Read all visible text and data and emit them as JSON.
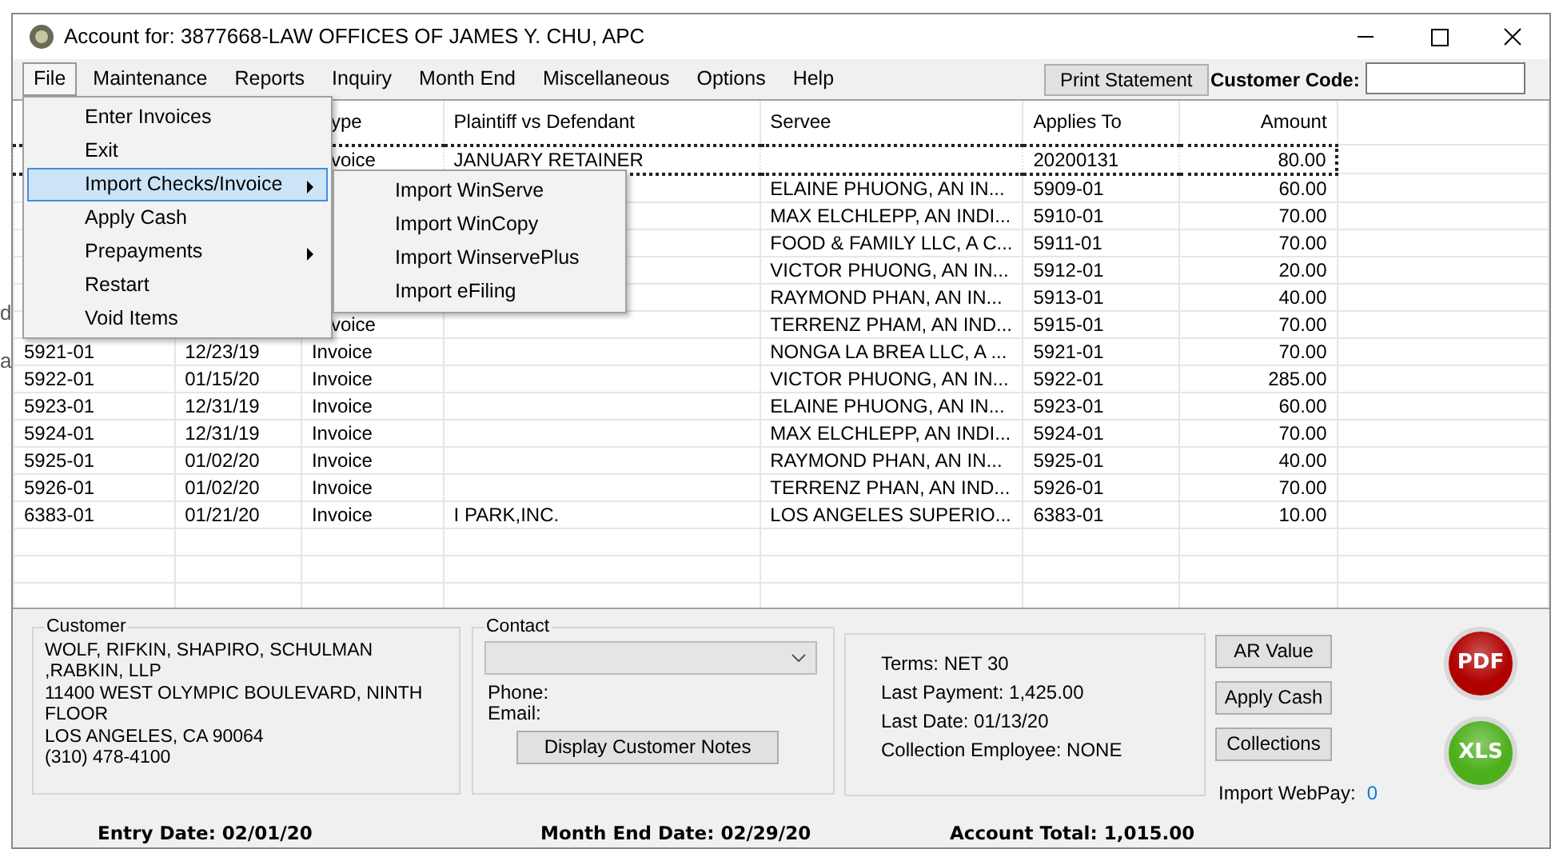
{
  "background_fragments": [
    "d",
    "a"
  ],
  "window": {
    "title": "Account for: 3877668-LAW OFFICES OF JAMES Y. CHU, APC"
  },
  "menu_bar": {
    "items": [
      {
        "label": "File",
        "selected": true
      },
      {
        "label": "Maintenance",
        "selected": false
      },
      {
        "label": "Reports",
        "selected": false
      },
      {
        "label": "Inquiry",
        "selected": false
      },
      {
        "label": "Month End",
        "selected": false
      },
      {
        "label": "Miscellaneous",
        "selected": false
      },
      {
        "label": "Options",
        "selected": false
      },
      {
        "label": "Help",
        "selected": false
      }
    ]
  },
  "print_button": "Print Statement",
  "customer_code": {
    "label": "Customer Code:"
  },
  "file_menu": {
    "items": [
      {
        "label": "Enter Invoices",
        "selected": false,
        "submenu": false
      },
      {
        "label": "Exit",
        "selected": false,
        "submenu": false
      },
      {
        "label": "Import Checks/Invoice",
        "selected": true,
        "submenu": true
      },
      {
        "label": "Apply Cash",
        "selected": false,
        "submenu": false
      },
      {
        "label": "Prepayments",
        "selected": false,
        "submenu": true
      },
      {
        "label": "Restart",
        "selected": false,
        "submenu": false
      },
      {
        "label": "Void Items",
        "selected": false,
        "submenu": false
      }
    ]
  },
  "submenu": {
    "items": [
      {
        "label": "Import WinServe",
        "selected": false
      },
      {
        "label": "Import WinCopy",
        "selected": false
      },
      {
        "label": "Import WinservePlus",
        "selected": false
      },
      {
        "label": "Import eFiling",
        "selected": false
      }
    ]
  },
  "table": {
    "columns": [
      null,
      null,
      "ype",
      "Plaintiff vs Defendant",
      "Servee",
      "Applies To",
      "Amount"
    ],
    "rows": [
      {
        "selected": true,
        "cells": [
          null,
          null,
          "voice",
          "JANUARY RETAINER",
          null,
          "20200131",
          "80.00"
        ]
      },
      {
        "selected": false,
        "cells": [
          null,
          null,
          null,
          null,
          "ELAINE PHUONG, AN IN...",
          "5909-01",
          "60.00"
        ]
      },
      {
        "selected": false,
        "cells": [
          null,
          null,
          null,
          null,
          "MAX ELCHLEPP, AN INDI...",
          "5910-01",
          "70.00"
        ]
      },
      {
        "selected": false,
        "cells": [
          null,
          null,
          null,
          null,
          "FOOD & FAMILY LLC, A C...",
          "5911-01",
          "70.00"
        ]
      },
      {
        "selected": false,
        "cells": [
          null,
          null,
          null,
          null,
          "VICTOR PHUONG, AN IN...",
          "5912-01",
          "20.00"
        ]
      },
      {
        "selected": false,
        "cells": [
          null,
          null,
          null,
          null,
          "RAYMOND PHAN, AN IN...",
          "5913-01",
          "40.00"
        ]
      },
      {
        "selected": false,
        "cells": [
          null,
          null,
          "voice",
          null,
          "TERRENZ PHAM, AN IND...",
          "5915-01",
          "70.00"
        ]
      },
      {
        "selected": false,
        "cells": [
          "5921-01",
          "12/23/19",
          "Invoice",
          null,
          "NONGA LA BREA LLC, A ...",
          "5921-01",
          "70.00"
        ]
      },
      {
        "selected": false,
        "cells": [
          "5922-01",
          "01/15/20",
          "Invoice",
          null,
          "VICTOR PHUONG, AN IN...",
          "5922-01",
          "285.00"
        ]
      },
      {
        "selected": false,
        "cells": [
          "5923-01",
          "12/31/19",
          "Invoice",
          null,
          "ELAINE PHUONG, AN IN...",
          "5923-01",
          "60.00"
        ]
      },
      {
        "selected": false,
        "cells": [
          "5924-01",
          "12/31/19",
          "Invoice",
          null,
          "MAX ELCHLEPP, AN INDI...",
          "5924-01",
          "70.00"
        ]
      },
      {
        "selected": false,
        "cells": [
          "5925-01",
          "01/02/20",
          "Invoice",
          null,
          "RAYMOND PHAN, AN IN...",
          "5925-01",
          "40.00"
        ]
      },
      {
        "selected": false,
        "cells": [
          "5926-01",
          "01/02/20",
          "Invoice",
          null,
          "TERRENZ PHAN, AN IND...",
          "5926-01",
          "70.00"
        ]
      },
      {
        "selected": false,
        "cells": [
          "6383-01",
          "01/21/20",
          "Invoice",
          "I PARK,INC.",
          "LOS ANGELES SUPERIO...",
          "6383-01",
          "10.00"
        ]
      }
    ]
  },
  "customer": {
    "label": "Customer",
    "lines": [
      "WOLF, RIFKIN, SHAPIRO, SCHULMAN ,RABKIN, LLP",
      "11400 WEST OLYMPIC BOULEVARD, NINTH FLOOR",
      "LOS ANGELES, CA 90064",
      "(310) 478-4100"
    ]
  },
  "contact": {
    "label": "Contact",
    "phone_label": "Phone:",
    "email_label": "Email:",
    "notes_button": "Display Customer Notes"
  },
  "account_info": [
    "Terms: NET 30",
    "Last Payment: 1,425.00",
    "Last Date: 01/13/20",
    "Collection Employee: NONE"
  ],
  "buttons": [
    "AR Value",
    "Apply Cash",
    "Collections"
  ],
  "import_webpay": {
    "label": "Import WebPay:",
    "value": "0"
  },
  "export_icons": [
    {
      "label": "PDF",
      "color": "#b00000"
    },
    {
      "label": "XLS",
      "color": "#4caf1c"
    }
  ],
  "status_bar": [
    "Entry Date: 02/01/20",
    "Month End Date: 02/29/20",
    "Account Total: 1,015.00"
  ]
}
